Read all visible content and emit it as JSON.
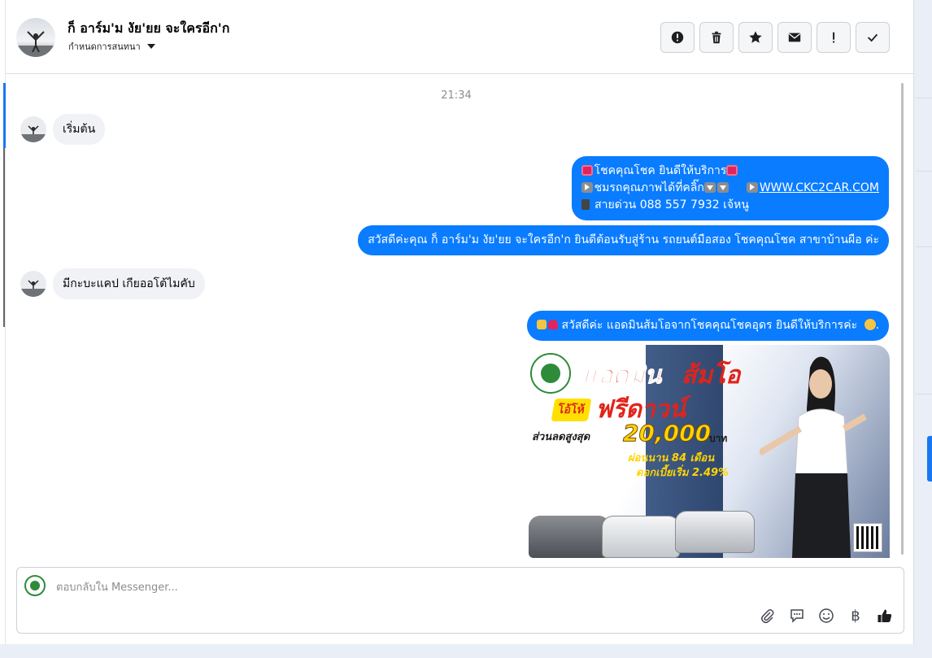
{
  "header": {
    "contact_name": "ก็ อาร์ม'ม งัย'ยย จะใครอีก'ก",
    "assign_label": "กำหนดการสนทนา",
    "actions": [
      {
        "name": "report-icon",
        "label": "report"
      },
      {
        "name": "trash-icon",
        "label": "delete"
      },
      {
        "name": "star-icon",
        "label": "star"
      },
      {
        "name": "mail-icon",
        "label": "unread"
      },
      {
        "name": "exclamation-icon",
        "label": "important"
      },
      {
        "name": "check-icon",
        "label": "done"
      }
    ]
  },
  "conversation": {
    "timestamp": "21:34",
    "incoming_1": "เริ่มต้น",
    "outgoing_1": {
      "line1": "โชคคุณโชค ยินดีให้บริการ",
      "line2_a": "ชมรถคุณภาพได้ที่คลิ๊ก",
      "line2_link": "WWW.CKC2CAR.COM",
      "line3": "สายด่วน 088 557 7932 เจ้หนู"
    },
    "outgoing_2": "สวัสดีค่ะคุณ ก็ อาร์ม'ม งัย'ยย จะใครอีก'ก ยินดีต้อนรับสู่ร้าน รถยนต์มือสอง โชคคุณโชค สาขาบ้านผือ ค่ะ",
    "incoming_2": "มีกะบะแคป  เกียออโต้ไมคับ",
    "outgoing_3": "สวัสดีค่ะ แอดมินส้มโอจากโชคคุณโชคอุดร ยินดีให้บริการค่ะ",
    "outgoing_3_tail": ".",
    "promo": {
      "title_a": "แอดมิน",
      "title_b": "ส้มโอ",
      "badge": "โอ้โห้",
      "headline": "ฟรีดาวน์",
      "discount_label": "ส่วนลดสูงสุด",
      "discount_amount": "20,000",
      "discount_unit": "บาท",
      "term": "ผ่อนนาน 84 เดือน",
      "rate": "ดอกเบี้ยเริ่ม 2.49%"
    }
  },
  "composer": {
    "placeholder": "ตอบกลับใน Messenger...",
    "tools": [
      "paperclip-icon",
      "saved-reply-icon",
      "emoji-icon",
      "baht-icon",
      "thumbs-up-icon"
    ],
    "baht_symbol": "฿"
  },
  "colors": {
    "outgoing_bubble": "#0a7cff",
    "incoming_bubble": "#f0f2f5",
    "accent": "#1877f2"
  }
}
